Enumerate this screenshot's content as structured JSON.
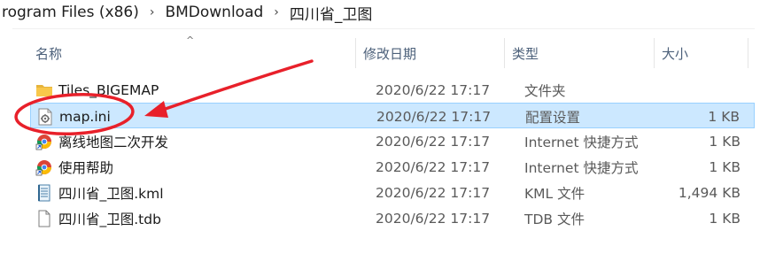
{
  "breadcrumb": {
    "segments": [
      "rogram Files (x86)",
      "BMDownload",
      "四川省_卫图"
    ],
    "separator": "›"
  },
  "columns": {
    "name": "名称",
    "date": "修改日期",
    "type": "类型",
    "size": "大小",
    "sort_indicator": "^"
  },
  "files": [
    {
      "name": "Tiles_BIGEMAP",
      "date": "2020/6/22 17:17",
      "type": "文件夹",
      "size": "",
      "icon": "folder-icon"
    },
    {
      "name": "map.ini",
      "date": "2020/6/22 17:17",
      "type": "配置设置",
      "size": "1 KB",
      "icon": "settings-file-icon",
      "selected": true
    },
    {
      "name": "离线地图二次开发",
      "date": "2020/6/22 17:17",
      "type": "Internet 快捷方式",
      "size": "1 KB",
      "icon": "internet-shortcut-icon"
    },
    {
      "name": "使用帮助",
      "date": "2020/6/22 17:17",
      "type": "Internet 快捷方式",
      "size": "1 KB",
      "icon": "internet-shortcut-icon"
    },
    {
      "name": "四川省_卫图.kml",
      "date": "2020/6/22 17:17",
      "type": "KML 文件",
      "size": "1,494 KB",
      "icon": "kml-file-icon"
    },
    {
      "name": "四川省_卫图.tdb",
      "date": "2020/6/22 17:17",
      "type": "TDB 文件",
      "size": "1 KB",
      "icon": "blank-file-icon"
    }
  ],
  "colors": {
    "selection_bg": "#cce8ff",
    "selection_border": "#99d1ff",
    "annotation_red": "#e8202a",
    "header_text": "#4c607a",
    "folder": "#f8c74a"
  }
}
